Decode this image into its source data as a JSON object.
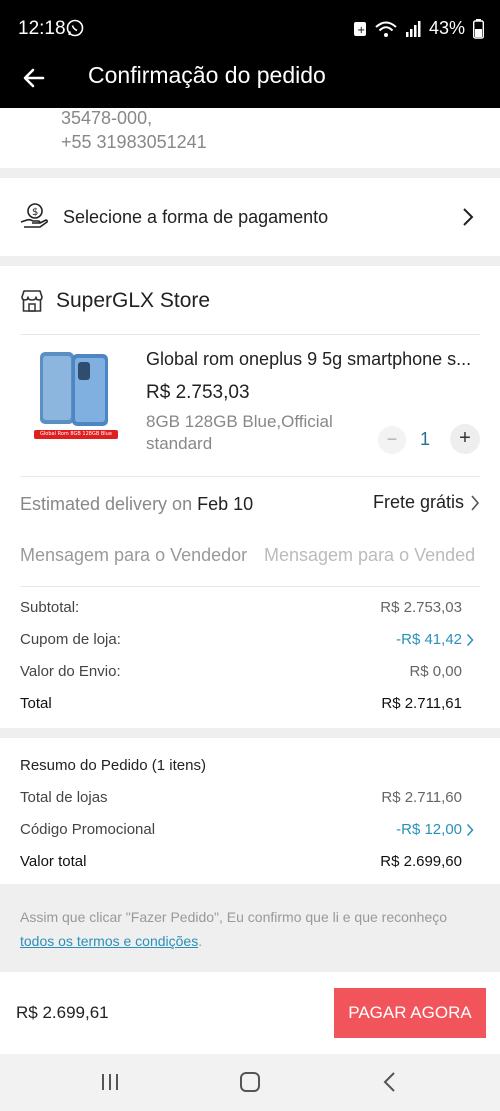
{
  "status": {
    "time": "12:18",
    "battery": "43%"
  },
  "header": {
    "title": "Confirmação do pedido"
  },
  "address": {
    "line1": "35478-000,",
    "line2": "+55 31983051241"
  },
  "payment": {
    "label": "Selecione a forma de pagamento"
  },
  "store": {
    "name": "SuperGLX Store",
    "product": {
      "title": "Global rom oneplus 9 5g smartphone s...",
      "price": "R$ 2.753,03",
      "variant": "8GB 128GB Blue,Official standard",
      "image_caption": "Global Rom 8GB 128GB Blue",
      "quantity": "1",
      "minus": "−",
      "plus": "+"
    },
    "delivery": {
      "prefix": "Estimated delivery on",
      "date": "Feb 10",
      "shipping": "Frete grátis"
    },
    "message": {
      "label": "Mensagem para o Vendedor",
      "placeholder": "Mensagem para o Vended"
    },
    "costs": {
      "subtotal_label": "Subtotal:",
      "subtotal_value": "R$ 2.753,03",
      "coupon_label": "Cupom de loja:",
      "coupon_value": "-R$ 41,42",
      "shipping_label": "Valor do Envio:",
      "shipping_value": "R$ 0,00",
      "total_label": "Total",
      "total_value": "R$ 2.711,61"
    }
  },
  "summary": {
    "title": "Resumo do Pedido (1 itens)",
    "stores_label": "Total de lojas",
    "stores_value": "R$ 2.711,60",
    "promo_label": "Código Promocional",
    "promo_value": "-R$ 12,00",
    "total_label": "Valor total",
    "total_value": "R$ 2.699,60"
  },
  "terms": {
    "text": "Assim que clicar \"Fazer Pedido\", Eu confirmo que li e que reconheço ",
    "link": "todos os termos e condições",
    "end": "."
  },
  "footer": {
    "amount": "R$ 2.699,61",
    "pay_button": "PAGAR AGORA"
  },
  "colors": {
    "accent": "#f2545b",
    "link": "#2b90b8",
    "quantity": "#2a6d95"
  },
  "icons": [
    "back-arrow-icon",
    "payment-hand-icon",
    "store-icon",
    "chevron-right-icon",
    "recent-apps-icon",
    "home-icon",
    "back-nav-icon"
  ]
}
